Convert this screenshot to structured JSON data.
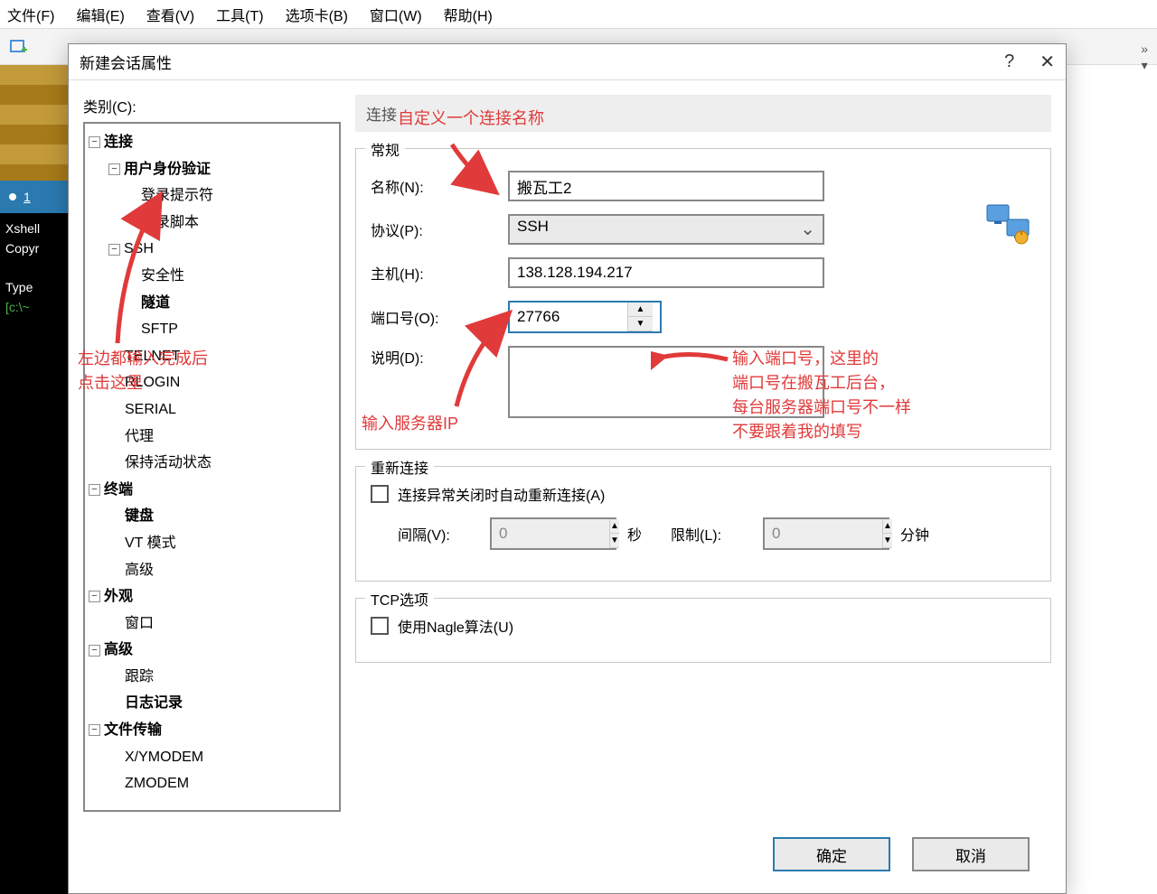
{
  "menubar": {
    "file": "文件(F)",
    "edit": "编辑(E)",
    "view": "查看(V)",
    "tools": "工具(T)",
    "tabs": "选项卡(B)",
    "window": "窗口(W)",
    "help": "帮助(H)"
  },
  "tab": {
    "name": "1"
  },
  "terminal": {
    "line1": "Xshell",
    "line2": "Copyr",
    "line3": "Type",
    "line4": "[c:\\~"
  },
  "dialog": {
    "title": "新建会话属性",
    "help": "?",
    "close": "✕",
    "category_label": "类别(C):",
    "section_header": "连接",
    "tree": {
      "connection": "连接",
      "auth": "用户身份验证",
      "login_prompt": "登录提示符",
      "login_script": "登录脚本",
      "ssh": "SSH",
      "security": "安全性",
      "tunnel": "隧道",
      "sftp": "SFTP",
      "telnet": "TELNET",
      "rlogin": "RLOGIN",
      "serial": "SERIAL",
      "proxy": "代理",
      "keepalive": "保持活动状态",
      "terminal": "终端",
      "keyboard": "键盘",
      "vt": "VT 模式",
      "advanced_term": "高级",
      "appearance": "外观",
      "window": "窗口",
      "advanced": "高级",
      "trace": "跟踪",
      "logging": "日志记录",
      "filetransfer": "文件传输",
      "xymodem": "X/YMODEM",
      "zmodem": "ZMODEM"
    },
    "general": {
      "legend": "常规",
      "name_label": "名称(N):",
      "name_value": "搬瓦工2",
      "protocol_label": "协议(P):",
      "protocol_value": "SSH",
      "host_label": "主机(H):",
      "host_value": "138.128.194.217",
      "port_label": "端口号(O):",
      "port_value": "27766",
      "desc_label": "说明(D):",
      "desc_value": ""
    },
    "reconnect": {
      "legend": "重新连接",
      "auto_label": "连接异常关闭时自动重新连接(A)",
      "interval_label": "间隔(V):",
      "interval_value": "0",
      "interval_unit": "秒",
      "limit_label": "限制(L):",
      "limit_value": "0",
      "limit_unit": "分钟"
    },
    "tcp": {
      "legend": "TCP选项",
      "nagle_label": "使用Nagle算法(U)"
    },
    "buttons": {
      "ok": "确定",
      "cancel": "取消"
    }
  },
  "annotations": {
    "name_hint": "自定义一个连接名称",
    "left_hint": "左边都输入完成后\n点击这里",
    "ip_hint": "输入服务器IP",
    "port_hint": "输入端口号，这里的\n端口号在搬瓦工后台，\n每台服务器端口号不一样\n不要跟着我的填写"
  }
}
